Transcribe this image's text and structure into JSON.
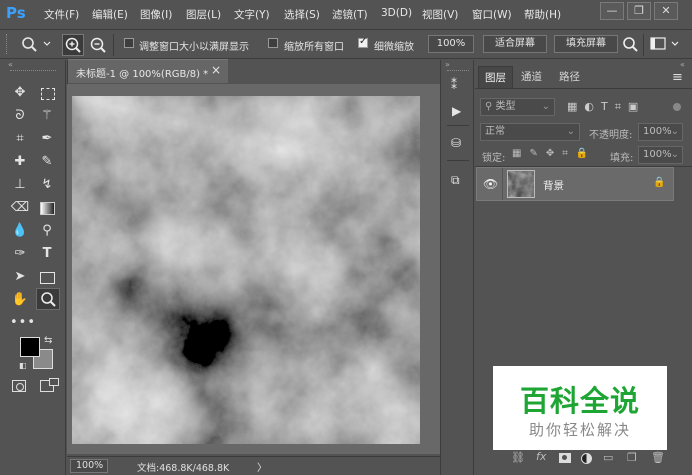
{
  "app": {
    "logo": "Ps"
  },
  "menu": [
    "文件(F)",
    "编辑(E)",
    "图像(I)",
    "图层(L)",
    "文字(Y)",
    "选择(S)",
    "滤镜(T)",
    "3D(D)",
    "视图(V)",
    "窗口(W)",
    "帮助(H)"
  ],
  "window_controls": {
    "minimize": "—",
    "restore": "❐",
    "close": "✕"
  },
  "options": {
    "resize_windows_label": "调整窗口大小以满屏显示",
    "resize_windows_checked": false,
    "zoom_all_label": "缩放所有窗口",
    "zoom_all_checked": false,
    "scrubby_label": "细微缩放",
    "scrubby_checked": true,
    "zoom_value": "100%",
    "fit_screen_label": "适合屏幕",
    "fill_screen_label": "填充屏幕"
  },
  "document": {
    "tab_title": "未标题-1 @ 100%(RGB/8) *",
    "tab_close": "×",
    "zoom": "100%",
    "doc_info": "文档:468.8K/468.8K",
    "status_arrow": "〉"
  },
  "colors": {
    "foreground": "#000000",
    "background": "#8a8a8a",
    "accent": "#3aa1ff"
  },
  "layers_panel": {
    "tabs": [
      "图层",
      "通道",
      "路径"
    ],
    "active_tab": "图层",
    "filter_kind": "类型",
    "blend_mode": "正常",
    "opacity_label": "不透明度:",
    "opacity_value": "100%",
    "lock_label": "锁定:",
    "fill_label": "填充:",
    "fill_value": "100%",
    "layers": [
      {
        "name": "背景",
        "locked": true,
        "visible": true
      }
    ],
    "bottom_icons": [
      "link-icon",
      "fx-icon",
      "mask-icon",
      "adjustment-icon",
      "folder-icon",
      "new-layer-icon",
      "trash-icon"
    ]
  },
  "watermark": {
    "title": "百科全说",
    "subtitle": "助你轻松解决"
  }
}
